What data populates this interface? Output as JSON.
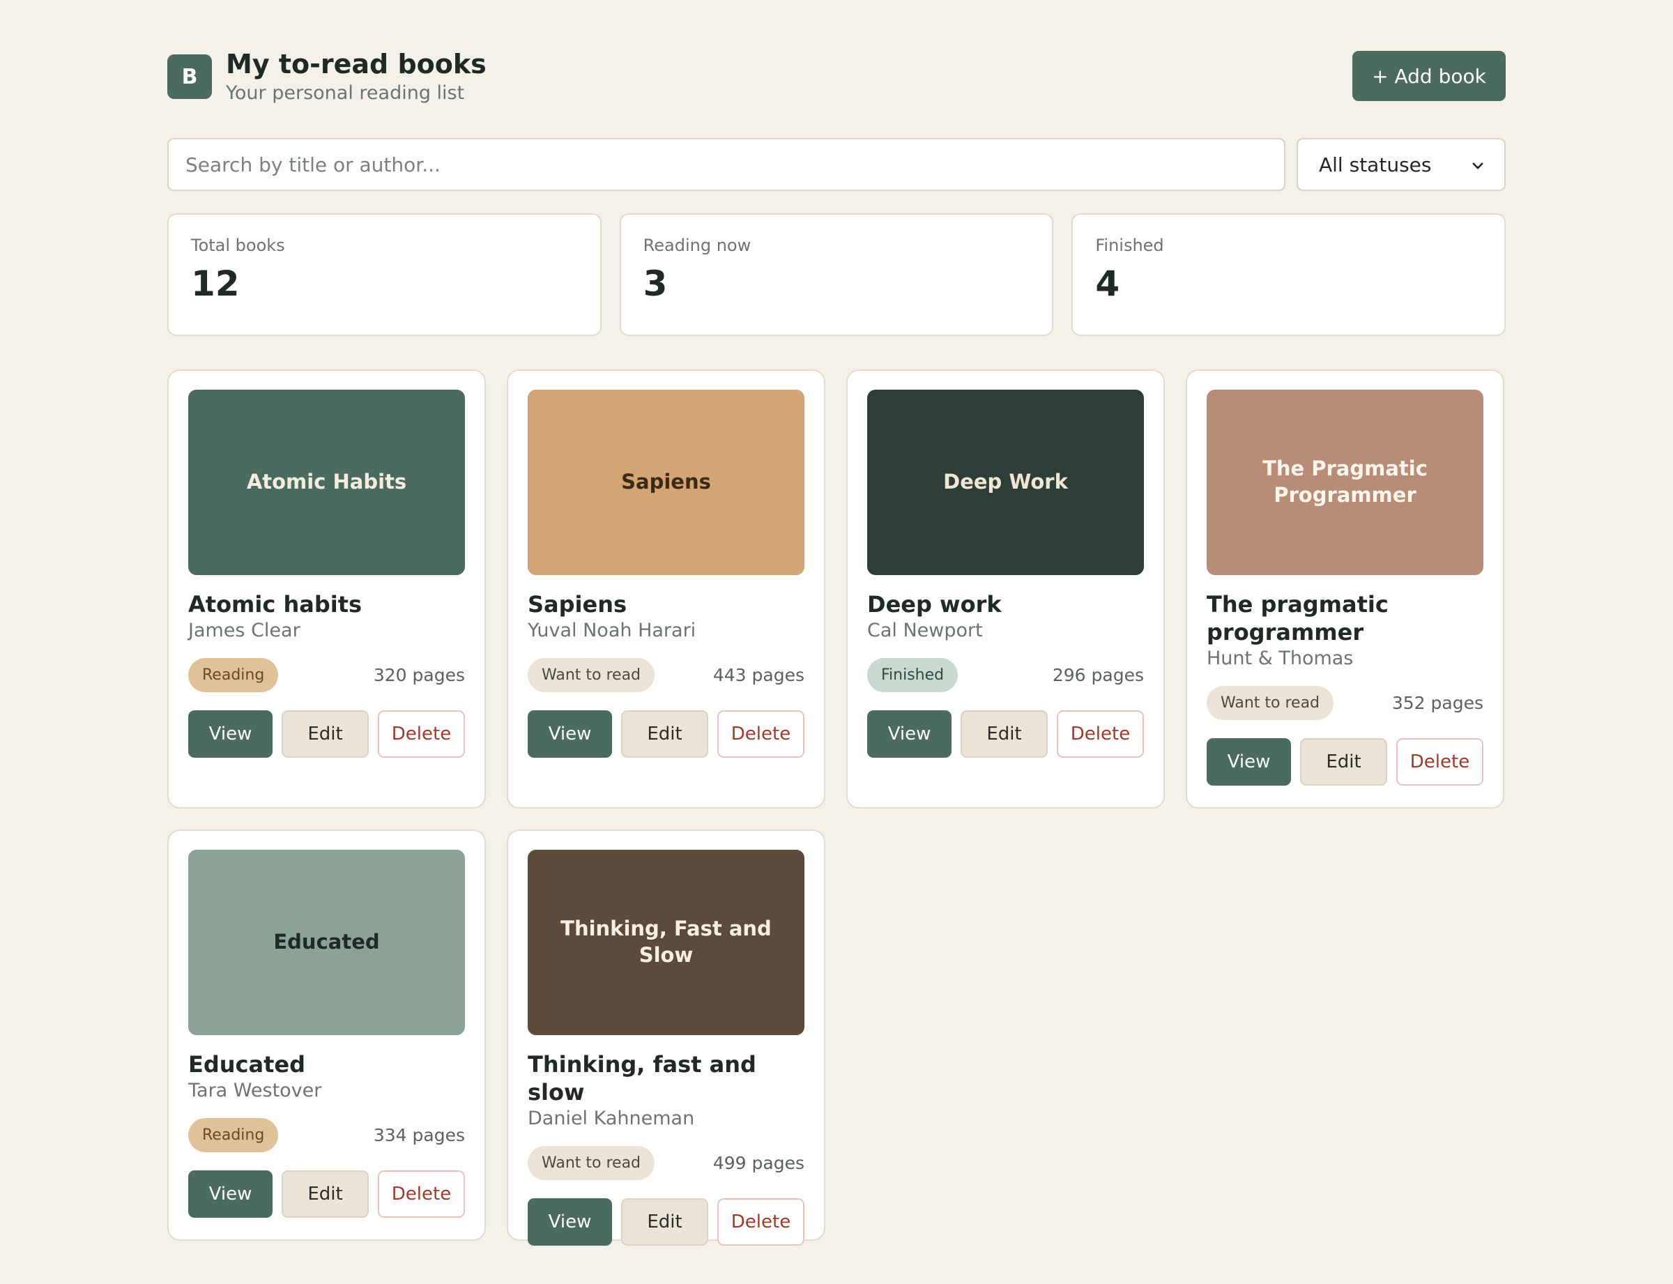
{
  "header": {
    "logo_letter": "B",
    "title": "My to-read books",
    "subtitle": "Your personal reading list",
    "add_button": "+ Add book"
  },
  "search": {
    "placeholder": "Search by title or author...",
    "value": ""
  },
  "filter": {
    "selected": "All statuses"
  },
  "stats": [
    {
      "label": "Total books",
      "value": "12"
    },
    {
      "label": "Reading now",
      "value": "3"
    },
    {
      "label": "Finished",
      "value": "4"
    }
  ],
  "book_actions": {
    "view": "View",
    "edit": "Edit",
    "delete": "Delete"
  },
  "books": [
    {
      "cover_title": "Atomic Habits",
      "cover_color": "#4a6b5d",
      "cover_text_color": "#f2ece1",
      "title": "Atomic habits",
      "author": "James Clear",
      "status": "Reading",
      "status_kind": "reading",
      "pages": "320 pages"
    },
    {
      "cover_title": "Sapiens",
      "cover_color": "#d4a574",
      "cover_text_color": "#3d2a14",
      "title": "Sapiens",
      "author": "Yuval Noah Harari",
      "status": "Want to read",
      "status_kind": "want",
      "pages": "443 pages"
    },
    {
      "cover_title": "Deep Work",
      "cover_color": "#2f3d37",
      "cover_text_color": "#efe7d6",
      "title": "Deep work",
      "author": "Cal Newport",
      "status": "Finished",
      "status_kind": "finished",
      "pages": "296 pages"
    },
    {
      "cover_title": "The Pragmatic Programmer",
      "cover_color": "#b88d78",
      "cover_text_color": "#fbf4ea",
      "title": "The pragmatic programmer",
      "author": "Hunt & Thomas",
      "status": "Want to read",
      "status_kind": "want",
      "pages": "352 pages"
    },
    {
      "cover_title": "Educated",
      "cover_color": "#8ba396",
      "cover_text_color": "#1f2a24",
      "title": "Educated",
      "author": "Tara Westover",
      "status": "Reading",
      "status_kind": "reading",
      "pages": "334 pages"
    },
    {
      "cover_title": "Thinking, Fast and Slow",
      "cover_color": "#5c4a3b",
      "cover_text_color": "#f7efe2",
      "title": "Thinking, fast and slow",
      "author": "Daniel Kahneman",
      "status": "Want to read",
      "status_kind": "want",
      "pages": "499 pages"
    }
  ]
}
